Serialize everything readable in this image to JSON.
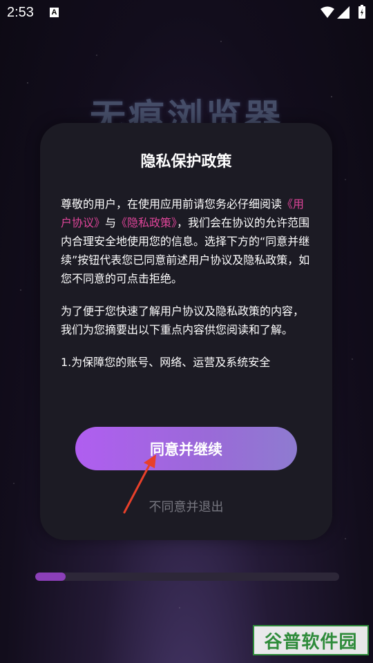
{
  "status_bar": {
    "time": "2:53",
    "notification_icon": "A"
  },
  "background": {
    "app_title": "无痕浏览器"
  },
  "modal": {
    "title": "隐私保护政策",
    "para1_prefix": "尊敬的用户，在使用应用前请您务必仔细阅读",
    "user_agreement_link": "《用户协议》",
    "para1_mid": "与",
    "privacy_policy_link": "《隐私政策》",
    "para1_suffix": "，我们会在协议的允许范围内合理安全地使用您的信息。选择下方的“同意并继续”按钮代表您已同意前述用户协议及隐私政策，如您不同意的可点击拒绝。",
    "para2": " 为了便于您快速了解用户协议及隐私政策的内容，我们为您摘要出以下重点内容供您阅读和了解。",
    "para3": " 1.为保障您的账号、网络、运营及系统安全",
    "agree_button": "同意并继续",
    "decline_link": "不同意并退出"
  },
  "loading": {
    "progress_fraction": 0.1
  },
  "watermark": {
    "text": "谷普软件园"
  },
  "colors": {
    "link": "#e0459a",
    "accent": "#b05ef0",
    "annotation_arrow": "#e8402a"
  }
}
